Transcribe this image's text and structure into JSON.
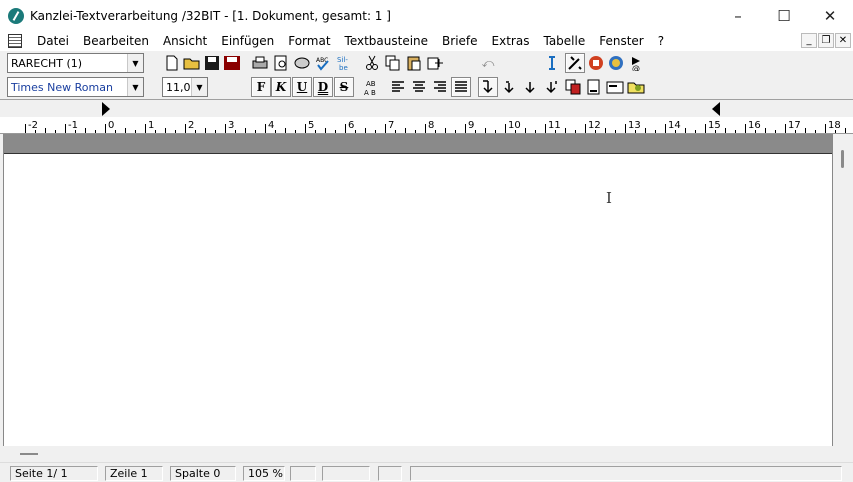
{
  "window": {
    "title": "Kanzlei-Textverarbeitung /32BIT - [1. Dokument, gesamt: 1  ]",
    "controls": {
      "minimize": "–",
      "maximize": "☐",
      "close": "✕"
    }
  },
  "menu": {
    "items": [
      "Datei",
      "Bearbeiten",
      "Ansicht",
      "Einfügen",
      "Format",
      "Textbausteine",
      "Briefe",
      "Extras",
      "Tabelle",
      "Fenster",
      "?"
    ],
    "mdi": {
      "minimize": "_",
      "restore": "❐",
      "close": "✕"
    }
  },
  "toolbar": {
    "style_value": "RARECHT (1)",
    "font_value": "Times New Roman",
    "size_value": "11,0",
    "bold_label": "F",
    "italic_label": "K",
    "underline_label": "U",
    "double_underline_label": "D",
    "strike_label": "S"
  },
  "ruler": {
    "labels": [
      "-2",
      "-1",
      "0",
      "1",
      "2",
      "3",
      "4",
      "5",
      "6",
      "7",
      "8",
      "9",
      "10",
      "11",
      "12",
      "13",
      "14",
      "15",
      "16",
      "17",
      "18"
    ]
  },
  "status": {
    "page": "Seite   1/   1",
    "line": "Zeile   1",
    "column": "Spalte   0",
    "zoom": "105 %"
  },
  "colors": {
    "app_icon": "#1b7a7a",
    "doc_band": "#8a8a8a"
  }
}
